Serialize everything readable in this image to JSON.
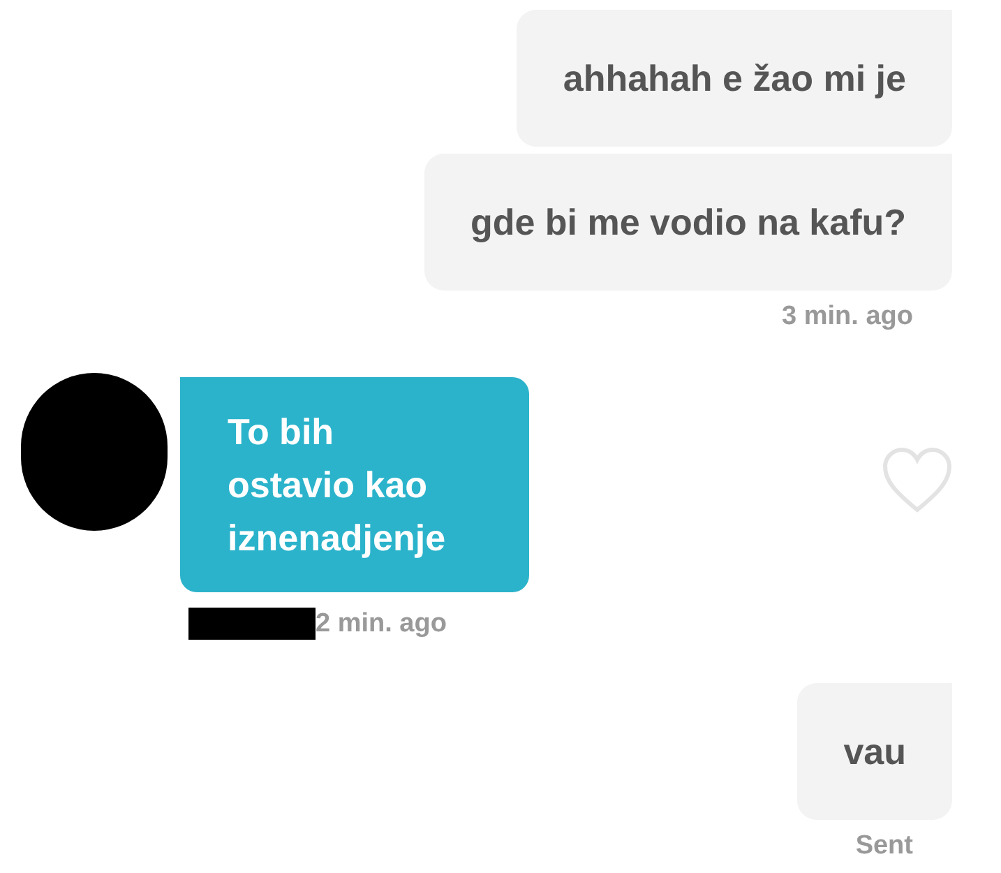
{
  "messages": [
    {
      "kind": "sent",
      "text": "ahhahah e žao mi je"
    },
    {
      "kind": "sent",
      "text": "gde bi me vodio na kafu?",
      "meta": "3 min. ago"
    },
    {
      "kind": "received",
      "text": "To bih\nostavio kao\niznenadjenje",
      "meta": "2 min. ago",
      "liked": false
    },
    {
      "kind": "sent",
      "text": "vau",
      "meta": "Sent"
    }
  ]
}
